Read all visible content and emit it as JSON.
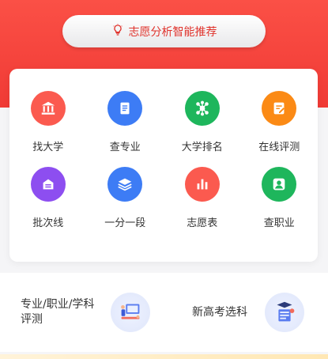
{
  "banner": {
    "label": "志愿分析智能推荐",
    "color": "#e0332c"
  },
  "menu_row1": [
    {
      "label": "找大学",
      "icon": "university-icon",
      "color": "#fb5a4f"
    },
    {
      "label": "查专业",
      "icon": "book-icon",
      "color": "#3d7cf5"
    },
    {
      "label": "大学排名",
      "icon": "network-icon",
      "color": "#1eb65c"
    },
    {
      "label": "在线评测",
      "icon": "test-icon",
      "color": "#fb8a15"
    }
  ],
  "menu_row2": [
    {
      "label": "批次线",
      "icon": "batch-icon",
      "color": "#8d4ef0"
    },
    {
      "label": "一分一段",
      "icon": "layers-icon",
      "color": "#3d7cf5"
    },
    {
      "label": "志愿表",
      "icon": "chart-bars-icon",
      "color": "#fb5a4f"
    },
    {
      "label": "查职业",
      "icon": "person-icon",
      "color": "#1eb65c"
    }
  ],
  "cards": [
    {
      "label_line1": "专业/职业/学科",
      "label_line2": "评测",
      "illustration": "team-illustration"
    },
    {
      "label_line1": "新高考选科",
      "label_line2": "",
      "illustration": "graduate-illustration"
    }
  ]
}
